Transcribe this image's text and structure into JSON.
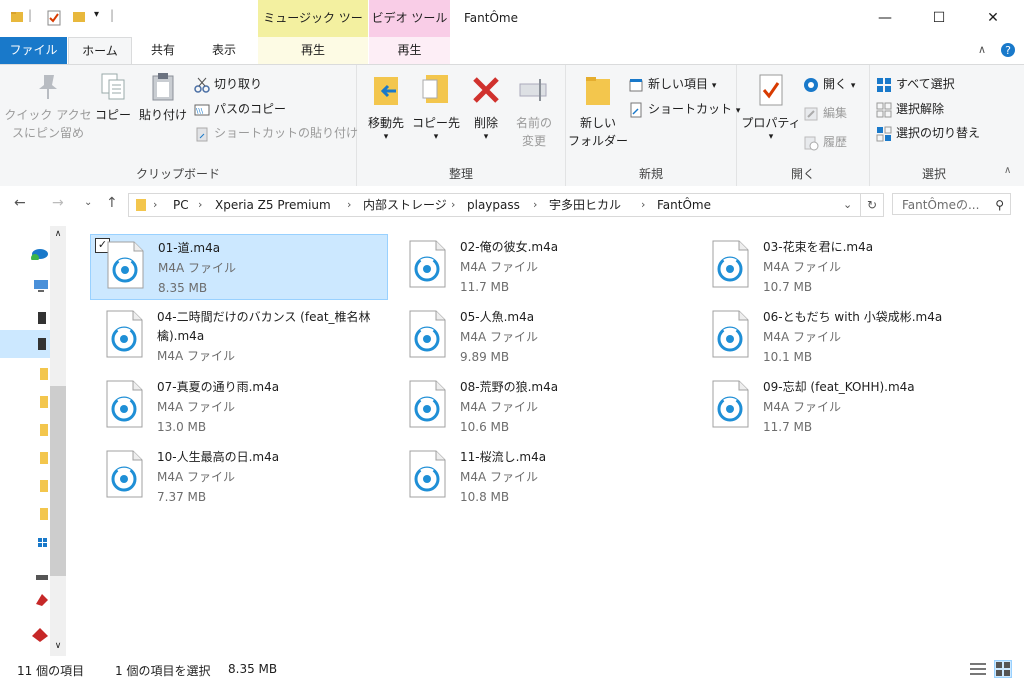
{
  "window": {
    "title": "FantÔme",
    "context_tabs": {
      "music": "ミュージック ツール",
      "video": "ビデオ ツール"
    },
    "controls": {
      "minimize": "—",
      "maximize": "☐",
      "close": "✕"
    }
  },
  "tabs": {
    "file": "ファイル",
    "home": "ホーム",
    "share": "共有",
    "view": "表示",
    "music_play": "再生",
    "video_play": "再生"
  },
  "ribbon": {
    "clipboard": {
      "label": "クリップボード",
      "pin_line1": "クイック アクセ",
      "pin_line2": "スにピン留め",
      "copy": "コピー",
      "paste": "貼り付け",
      "cut": "切り取り",
      "copy_path": "パスのコピー",
      "paste_shortcut": "ショートカットの貼り付け"
    },
    "organize": {
      "label": "整理",
      "move_to": "移動先",
      "copy_to": "コピー先",
      "delete": "削除",
      "rename_line1": "名前の",
      "rename_line2": "変更"
    },
    "new": {
      "label": "新規",
      "new_folder_line1": "新しい",
      "new_folder_line2": "フォルダー",
      "new_item": "新しい項目",
      "shortcut": "ショートカット"
    },
    "open": {
      "label": "開く",
      "properties": "プロパティ",
      "open": "開く",
      "edit": "編集",
      "history": "履歴"
    },
    "select": {
      "label": "選択",
      "select_all": "すべて選択",
      "select_none": "選択解除",
      "invert": "選択の切り替え"
    }
  },
  "address": {
    "breadcrumbs": [
      "PC",
      "Xperia Z5 Premium",
      "内部ストレージ",
      "playpass",
      "宇多田ヒカル",
      "FantÔme"
    ],
    "search_placeholder": "FantÔmeの..."
  },
  "files": [
    {
      "name": "01-道.m4a",
      "type": "M4A ファイル",
      "size": "8.35 MB",
      "selected": true
    },
    {
      "name": "02-俺の彼女.m4a",
      "type": "M4A ファイル",
      "size": "11.7 MB"
    },
    {
      "name": "03-花束を君に.m4a",
      "type": "M4A ファイル",
      "size": "10.7 MB"
    },
    {
      "name": "04-二時間だけのバカンス (feat_椎名林檎).m4a",
      "type": "M4A ファイル",
      "size": ""
    },
    {
      "name": "05-人魚.m4a",
      "type": "M4A ファイル",
      "size": "9.89 MB"
    },
    {
      "name": "06-ともだち with 小袋成彬.m4a",
      "type": "M4A ファイル",
      "size": "10.1 MB"
    },
    {
      "name": "07-真夏の通り雨.m4a",
      "type": "M4A ファイル",
      "size": "13.0 MB"
    },
    {
      "name": "08-荒野の狼.m4a",
      "type": "M4A ファイル",
      "size": "10.6 MB"
    },
    {
      "name": "09-忘却 (feat_KOHH).m4a",
      "type": "M4A ファイル",
      "size": "11.7 MB"
    },
    {
      "name": "10-人生最高の日.m4a",
      "type": "M4A ファイル",
      "size": "7.37 MB"
    },
    {
      "name": "11-桜流し.m4a",
      "type": "M4A ファイル",
      "size": "10.8 MB"
    }
  ],
  "status": {
    "count": "11 個の項目",
    "selection": "1 個の項目を選択",
    "selection_size": "8.35 MB"
  },
  "colors": {
    "accent": "#1979ca",
    "selected_bg": "#cce8ff",
    "selected_border": "#99d1ff"
  }
}
